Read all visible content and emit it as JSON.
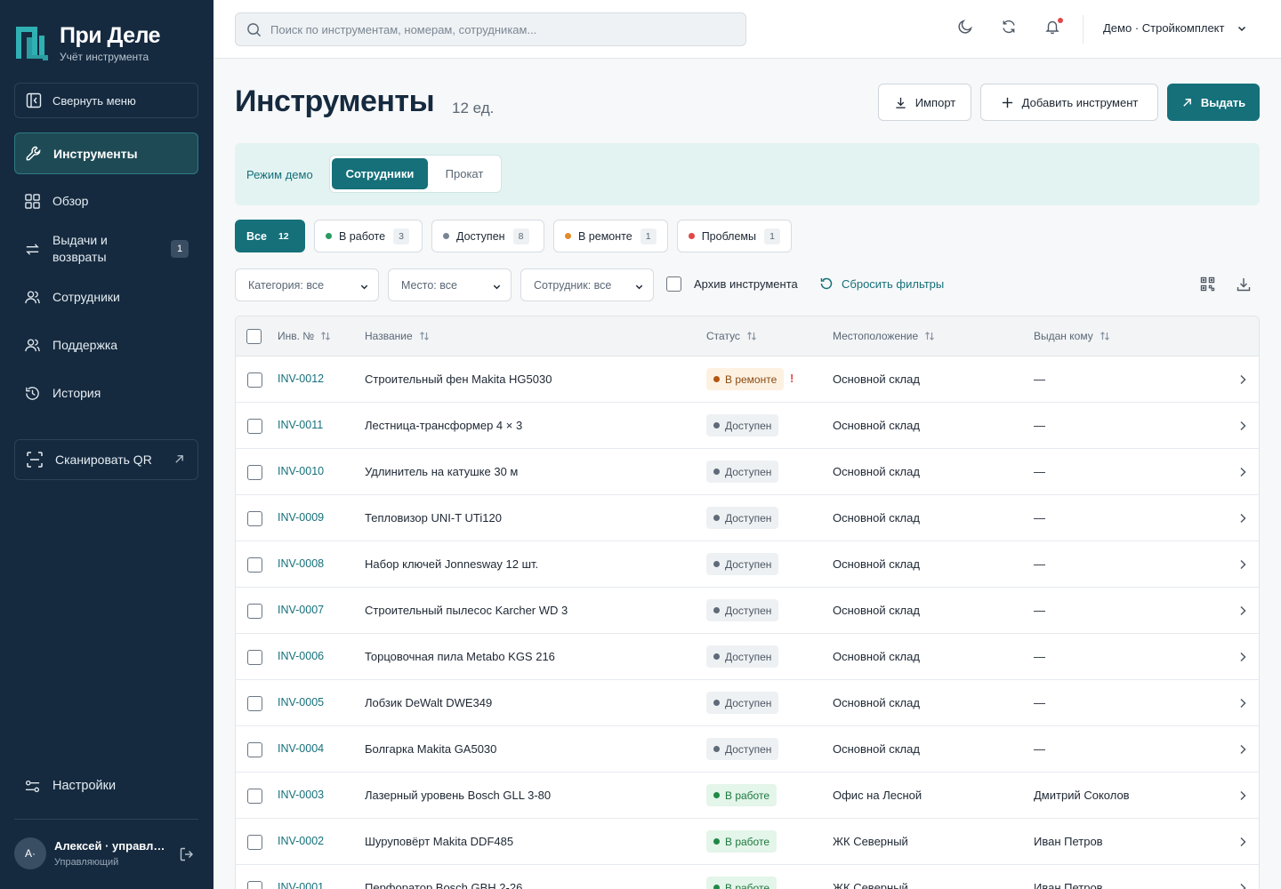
{
  "brand": {
    "title": "При Деле",
    "subtitle": "Учёт инструмента"
  },
  "sidebar": {
    "collapse_label": "Свернуть меню",
    "items": [
      {
        "label": "Инструменты",
        "icon": "wrench-icon",
        "active": true
      },
      {
        "label": "Обзор",
        "icon": "grid-icon"
      },
      {
        "label": "Выдачи и возвраты",
        "icon": "swap-arrows-icon",
        "badge": "1"
      },
      {
        "label": "Сотрудники",
        "icon": "users-icon"
      },
      {
        "label": "Поддержка",
        "icon": "support-icon"
      },
      {
        "label": "История",
        "icon": "history-icon"
      }
    ],
    "scan_label": "Сканировать QR",
    "settings_label": "Настройки",
    "user": {
      "initials": "А·",
      "name": "Алексей · управляющий",
      "role": "Управляющий"
    }
  },
  "topbar": {
    "search_placeholder": "Поиск по инструментам, номерам, сотрудникам...",
    "org": "Демо · Стройкомплект"
  },
  "page": {
    "title": "Инструменты",
    "count": "12 ед.",
    "import_label": "Импорт",
    "add_label": "Добавить инструмент",
    "issue_label": "Выдать"
  },
  "mode": {
    "label": "Режим демо",
    "options": [
      "Сотрудники",
      "Прокат"
    ],
    "selected": "Сотрудники"
  },
  "filters": {
    "chips": [
      {
        "label": "Все",
        "count": "12",
        "active": true
      },
      {
        "label": "В работе",
        "count": "3",
        "dot": "#2a9a63"
      },
      {
        "label": "Доступен",
        "count": "8",
        "dot": "#7a8592"
      },
      {
        "label": "В ремонте",
        "count": "1",
        "dot": "#e38a2a"
      },
      {
        "label": "Проблемы",
        "count": "1",
        "dot": "#e04848"
      }
    ],
    "category": "Категория: все",
    "place": "Место: все",
    "employee": "Сотрудник: все",
    "archive_label": "Архив инструмента",
    "reset_label": "Сбросить фильтры"
  },
  "table": {
    "columns": {
      "inv": "Инв. №",
      "name": "Название",
      "status": "Статус",
      "location": "Местоположение",
      "assignee": "Выдан кому"
    },
    "rows": [
      {
        "inv": "INV-0012",
        "name": "Строительный фен Makita HG5030",
        "status": "В ремонте",
        "kind": "repair",
        "warn": "!",
        "location": "Основной склад",
        "assignee": "—"
      },
      {
        "inv": "INV-0011",
        "name": "Лестница-трансформер 4 × 3",
        "status": "Доступен",
        "kind": "avail",
        "location": "Основной склад",
        "assignee": "—"
      },
      {
        "inv": "INV-0010",
        "name": "Удлинитель на катушке 30 м",
        "status": "Доступен",
        "kind": "avail",
        "location": "Основной склад",
        "assignee": "—"
      },
      {
        "inv": "INV-0009",
        "name": "Тепловизор UNI-T UTi120",
        "status": "Доступен",
        "kind": "avail",
        "location": "Основной склад",
        "assignee": "—"
      },
      {
        "inv": "INV-0008",
        "name": "Набор ключей Jonnesway 12 шт.",
        "status": "Доступен",
        "kind": "avail",
        "location": "Основной склад",
        "assignee": "—"
      },
      {
        "inv": "INV-0007",
        "name": "Строительный пылесос Karcher WD 3",
        "status": "Доступен",
        "kind": "avail",
        "location": "Основной склад",
        "assignee": "—"
      },
      {
        "inv": "INV-0006",
        "name": "Торцовочная пила Metabo KGS 216",
        "status": "Доступен",
        "kind": "avail",
        "location": "Основной склад",
        "assignee": "—"
      },
      {
        "inv": "INV-0005",
        "name": "Лобзик DeWalt DWE349",
        "status": "Доступен",
        "kind": "avail",
        "location": "Основной склад",
        "assignee": "—"
      },
      {
        "inv": "INV-0004",
        "name": "Болгарка Makita GA5030",
        "status": "Доступен",
        "kind": "avail",
        "location": "Основной склад",
        "assignee": "—"
      },
      {
        "inv": "INV-0003",
        "name": "Лазерный уровень Bosch GLL 3-80",
        "status": "В работе",
        "kind": "work",
        "location": "Офис на Лесной",
        "assignee": "Дмитрий Соколов"
      },
      {
        "inv": "INV-0002",
        "name": "Шуруповёрт Makita DDF485",
        "status": "В работе",
        "kind": "work",
        "location": "ЖК Северный",
        "assignee": "Иван Петров"
      },
      {
        "inv": "INV-0001",
        "name": "Перфоратор Bosch GBH 2-26",
        "status": "В работе",
        "kind": "work",
        "location": "ЖК Северный",
        "assignee": "Иван Петров"
      }
    ]
  }
}
